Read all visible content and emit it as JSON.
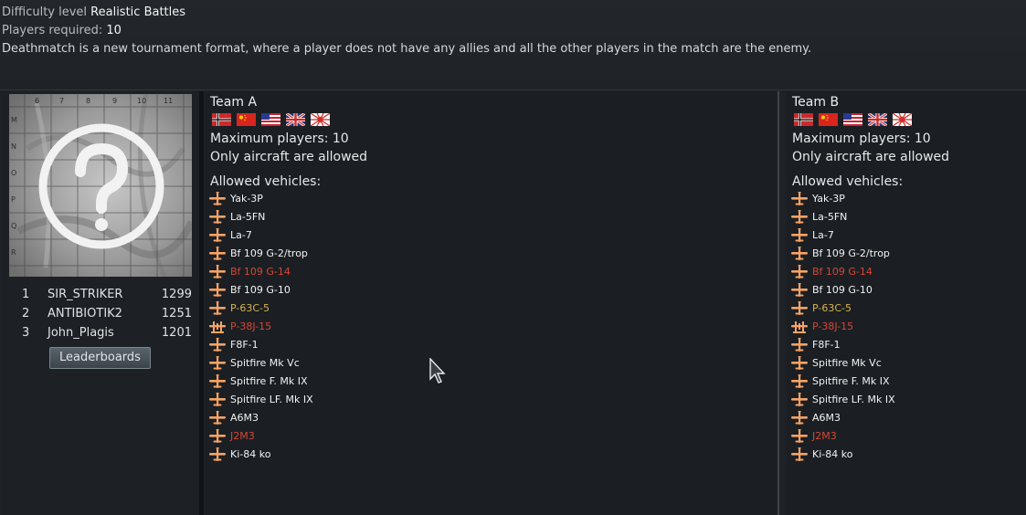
{
  "event": {
    "difficulty_label": "Difficulty level",
    "difficulty_value": "Realistic Battles",
    "players_label": "Players required:",
    "players_value": "10",
    "description": "Deathmatch is a new tournament format, where a player does not have any allies and all the other players in the match are the enemy."
  },
  "map": {
    "icon": "question-mark-icon",
    "col_labels": [
      "6",
      "7",
      "8",
      "9",
      "10",
      "11"
    ],
    "row_labels": [
      "M",
      "N",
      "O",
      "P",
      "Q",
      "R"
    ]
  },
  "leaderboard": {
    "rows": [
      {
        "rank": "1",
        "name": "SIR_STRIKER",
        "score": "1299"
      },
      {
        "rank": "2",
        "name": "ANTIBIOTIK2",
        "score": "1251"
      },
      {
        "rank": "3",
        "name": "John_Plagis",
        "score": "1201"
      }
    ],
    "button_label": "Leaderboards"
  },
  "colors": {
    "normal": "#f2f2f2",
    "premium": "#d64637",
    "gold": "#d9b24c",
    "icon": "#f7a365"
  },
  "teams": {
    "a": {
      "title": "Team A",
      "flags": [
        "germany-flag-icon",
        "china-flag-icon",
        "usa-flag-icon",
        "uk-flag-icon",
        "japan-flag-icon"
      ],
      "max_players": "Maximum players: 10",
      "restriction": "Only aircraft are allowed",
      "allowed_label": "Allowed vehicles:",
      "vehicles": [
        {
          "name": "Yak-3P",
          "color": "#f2f2f2",
          "icon": "fighter-plane-icon"
        },
        {
          "name": "La-5FN",
          "color": "#f2f2f2",
          "icon": "fighter-plane-icon"
        },
        {
          "name": "La-7",
          "color": "#f2f2f2",
          "icon": "fighter-plane-icon"
        },
        {
          "name": "Bf 109 G-2/trop",
          "color": "#f2f2f2",
          "icon": "fighter-plane-icon"
        },
        {
          "name": "Bf 109 G-14",
          "color": "#d64637",
          "icon": "fighter-plane-icon"
        },
        {
          "name": "Bf 109 G-10",
          "color": "#f2f2f2",
          "icon": "fighter-plane-icon"
        },
        {
          "name": "P-63C-5",
          "color": "#d9b24c",
          "icon": "fighter-plane-icon"
        },
        {
          "name": "P-38J-15",
          "color": "#d64637",
          "icon": "twin-engine-fighter-icon"
        },
        {
          "name": "F8F-1",
          "color": "#f2f2f2",
          "icon": "fighter-plane-icon"
        },
        {
          "name": "Spitfire Mk Vc",
          "color": "#f2f2f2",
          "icon": "fighter-plane-icon"
        },
        {
          "name": "Spitfire F. Mk IX",
          "color": "#f2f2f2",
          "icon": "fighter-plane-icon"
        },
        {
          "name": "Spitfire LF. Mk IX",
          "color": "#f2f2f2",
          "icon": "fighter-plane-icon"
        },
        {
          "name": "A6M3",
          "color": "#f2f2f2",
          "icon": "fighter-plane-icon"
        },
        {
          "name": "J2M3",
          "color": "#d64637",
          "icon": "fighter-plane-icon"
        },
        {
          "name": "Ki-84 ko",
          "color": "#f2f2f2",
          "icon": "fighter-plane-icon"
        }
      ]
    },
    "b": {
      "title": "Team B",
      "flags": [
        "germany-flag-icon",
        "china-flag-icon",
        "usa-flag-icon",
        "uk-flag-icon",
        "japan-flag-icon"
      ],
      "max_players": "Maximum players: 10",
      "restriction": "Only aircraft are allowed",
      "allowed_label": "Allowed vehicles:",
      "vehicles": [
        {
          "name": "Yak-3P",
          "color": "#f2f2f2",
          "icon": "fighter-plane-icon"
        },
        {
          "name": "La-5FN",
          "color": "#f2f2f2",
          "icon": "fighter-plane-icon"
        },
        {
          "name": "La-7",
          "color": "#f2f2f2",
          "icon": "fighter-plane-icon"
        },
        {
          "name": "Bf 109 G-2/trop",
          "color": "#f2f2f2",
          "icon": "fighter-plane-icon"
        },
        {
          "name": "Bf 109 G-14",
          "color": "#d64637",
          "icon": "fighter-plane-icon"
        },
        {
          "name": "Bf 109 G-10",
          "color": "#f2f2f2",
          "icon": "fighter-plane-icon"
        },
        {
          "name": "P-63C-5",
          "color": "#d9b24c",
          "icon": "fighter-plane-icon"
        },
        {
          "name": "P-38J-15",
          "color": "#d64637",
          "icon": "twin-engine-fighter-icon"
        },
        {
          "name": "F8F-1",
          "color": "#f2f2f2",
          "icon": "fighter-plane-icon"
        },
        {
          "name": "Spitfire Mk Vc",
          "color": "#f2f2f2",
          "icon": "fighter-plane-icon"
        },
        {
          "name": "Spitfire F. Mk IX",
          "color": "#f2f2f2",
          "icon": "fighter-plane-icon"
        },
        {
          "name": "Spitfire LF. Mk IX",
          "color": "#f2f2f2",
          "icon": "fighter-plane-icon"
        },
        {
          "name": "A6M3",
          "color": "#f2f2f2",
          "icon": "fighter-plane-icon"
        },
        {
          "name": "J2M3",
          "color": "#d64637",
          "icon": "fighter-plane-icon"
        },
        {
          "name": "Ki-84 ko",
          "color": "#f2f2f2",
          "icon": "fighter-plane-icon"
        }
      ]
    }
  }
}
